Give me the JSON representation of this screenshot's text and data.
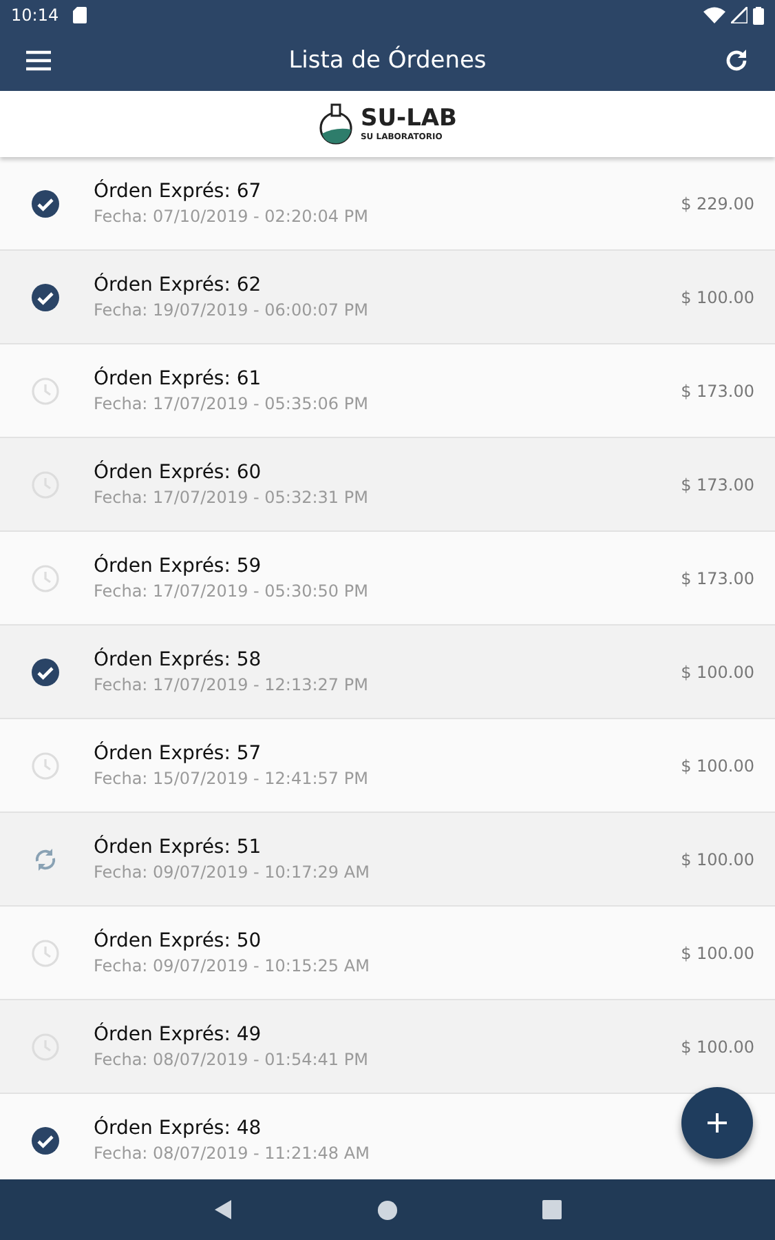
{
  "status_bar": {
    "time": "10:14"
  },
  "toolbar": {
    "title": "Lista de Órdenes"
  },
  "logo": {
    "name": "SU-LAB",
    "tagline": "SU LABORATORIO"
  },
  "orders": [
    {
      "title": "Órden Exprés: 67",
      "date": "Fecha: 07/10/2019 - 02:20:04 PM",
      "price": "$ 229.00",
      "kind": "done"
    },
    {
      "title": "Órden Exprés: 62",
      "date": "Fecha: 19/07/2019 - 06:00:07 PM",
      "price": "$ 100.00",
      "kind": "done"
    },
    {
      "title": "Órden Exprés: 61",
      "date": "Fecha: 17/07/2019 - 05:35:06 PM",
      "price": "$ 173.00",
      "kind": "pending"
    },
    {
      "title": "Órden Exprés: 60",
      "date": "Fecha: 17/07/2019 - 05:32:31 PM",
      "price": "$ 173.00",
      "kind": "pending"
    },
    {
      "title": "Órden Exprés: 59",
      "date": "Fecha: 17/07/2019 - 05:30:50 PM",
      "price": "$ 173.00",
      "kind": "pending"
    },
    {
      "title": "Órden Exprés: 58",
      "date": "Fecha: 17/07/2019 - 12:13:27 PM",
      "price": "$ 100.00",
      "kind": "done"
    },
    {
      "title": "Órden Exprés: 57",
      "date": "Fecha: 15/07/2019 - 12:41:57 PM",
      "price": "$ 100.00",
      "kind": "pending"
    },
    {
      "title": "Órden Exprés: 51",
      "date": "Fecha: 09/07/2019 - 10:17:29 AM",
      "price": "$ 100.00",
      "kind": "syncing"
    },
    {
      "title": "Órden Exprés: 50",
      "date": "Fecha: 09/07/2019 - 10:15:25 AM",
      "price": "$ 100.00",
      "kind": "pending"
    },
    {
      "title": "Órden Exprés: 49",
      "date": "Fecha: 08/07/2019 - 01:54:41 PM",
      "price": "$ 100.00",
      "kind": "pending"
    },
    {
      "title": "Órden Exprés: 48",
      "date": "Fecha: 08/07/2019 - 11:21:48 AM",
      "kind": "done"
    }
  ]
}
